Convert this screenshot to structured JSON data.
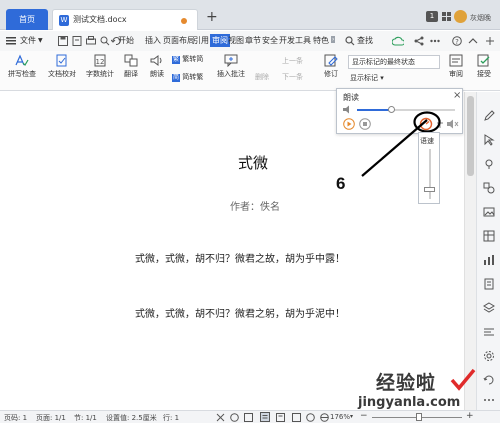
{
  "titlebar": {
    "home_tab": "首页",
    "doc_tab": "测试文档.docx",
    "doc_icon": "W",
    "new_tab": "+",
    "window_count": "1",
    "username": "灰烟晚"
  },
  "menubar": {
    "file_menu": "文件",
    "items": [
      "开始",
      "插入",
      "页面布局",
      "引用",
      "审阅",
      "视图",
      "章节",
      "安全",
      "开发工具",
      "特色"
    ],
    "search_label": "查找"
  },
  "ribbon": {
    "spellcheck": "拼写检查",
    "doc_check": "文档校对",
    "word_count": "字数统计",
    "translate": "翻译",
    "read_aloud": "朗读",
    "trad_to_simp": "繁转简",
    "simp_to_trad": "简转繁",
    "insert_comment": "插入批注",
    "delete": "删除",
    "prev": "上一条",
    "next": "下一条",
    "track_changes": "修订",
    "markup_mode": "显示标记的最终状态",
    "show_markup": "显示标记",
    "review": "审阅",
    "accept": "接受"
  },
  "document": {
    "title": "式微",
    "author": "作者：佚名",
    "line1": "式微，式微，胡不归？微君之故，胡为乎中露！",
    "line2": "式微，式微，胡不归？微君之躬，胡为乎泥中！"
  },
  "read_panel": {
    "title": "朗读",
    "close": "×",
    "volume_level": 0.35,
    "speed_label": "语速"
  },
  "annotation": {
    "number": "6"
  },
  "statusbar": {
    "page_no": "页码: 1",
    "pages": "页面: 1/1",
    "section": "节: 1/1",
    "setting": "设置值: 2.5厘米",
    "line": "行: 1",
    "zoom": "176%"
  },
  "watermark": {
    "text": "经验啦",
    "url": "jingyanla.com"
  },
  "colors": {
    "accent": "#2f6bd9",
    "highlight_circle": "#000000",
    "speed_icon": "#e5622e"
  }
}
